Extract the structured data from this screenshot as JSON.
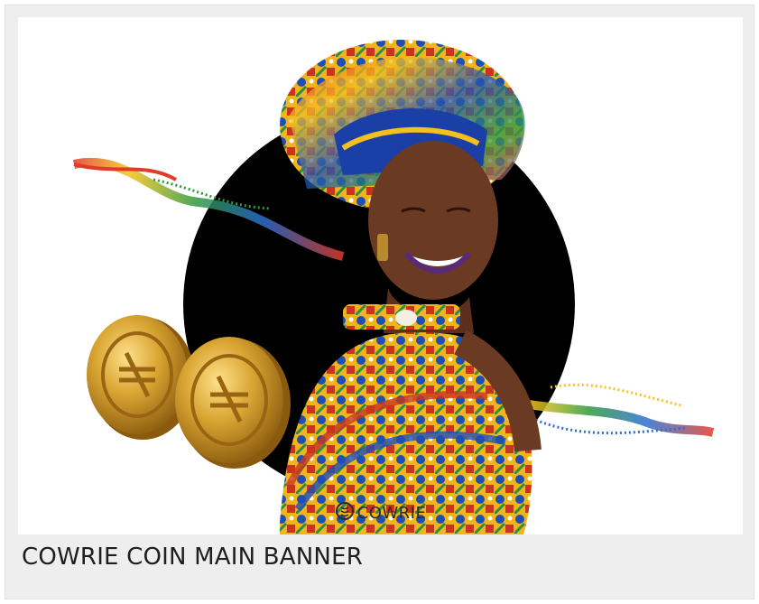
{
  "banner": {
    "brand_word": "COWRIE",
    "logo_icon": "cowrie-shell-logo-icon",
    "coin_icon": "naira-coin-icon"
  },
  "caption": {
    "title": "COWRIE COIN MAIN BANNER"
  },
  "colors": {
    "card_bg": "#eeeeee",
    "banner_bg": "#ffffff",
    "circle": "#000000",
    "gold": "#d4a236",
    "skin": "#6b3a22"
  }
}
